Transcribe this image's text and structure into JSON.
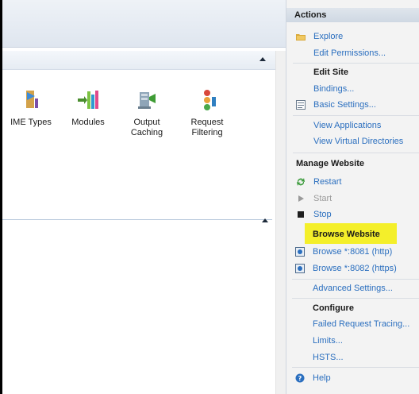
{
  "features": [
    {
      "label": "IME Types",
      "icon": "mime-types-icon"
    },
    {
      "label": "Modules",
      "icon": "modules-icon"
    },
    {
      "label": "Output\nCaching",
      "icon": "output-caching-icon"
    },
    {
      "label": "Request\nFiltering",
      "icon": "request-filtering-icon"
    }
  ],
  "actions": {
    "title": "Actions",
    "explore": "Explore",
    "edit_permissions": "Edit Permissions...",
    "edit_site": "Edit Site",
    "bindings": "Bindings...",
    "basic_settings": "Basic Settings...",
    "view_applications": "View Applications",
    "view_virtual_directories": "View Virtual Directories",
    "manage_website": "Manage Website",
    "restart": "Restart",
    "start": "Start",
    "stop": "Stop",
    "browse_website": "Browse Website",
    "browse_http": "Browse *:8081 (http)",
    "browse_https": "Browse *:8082 (https)",
    "advanced_settings": "Advanced Settings...",
    "configure": "Configure",
    "failed_request_tracing": "Failed Request Tracing...",
    "limits": "Limits...",
    "hsts": "HSTS...",
    "help": "Help"
  },
  "colors": {
    "link": "#2b6fbf",
    "highlight": "#f4ef2a",
    "disabled": "#9a9a9a"
  }
}
